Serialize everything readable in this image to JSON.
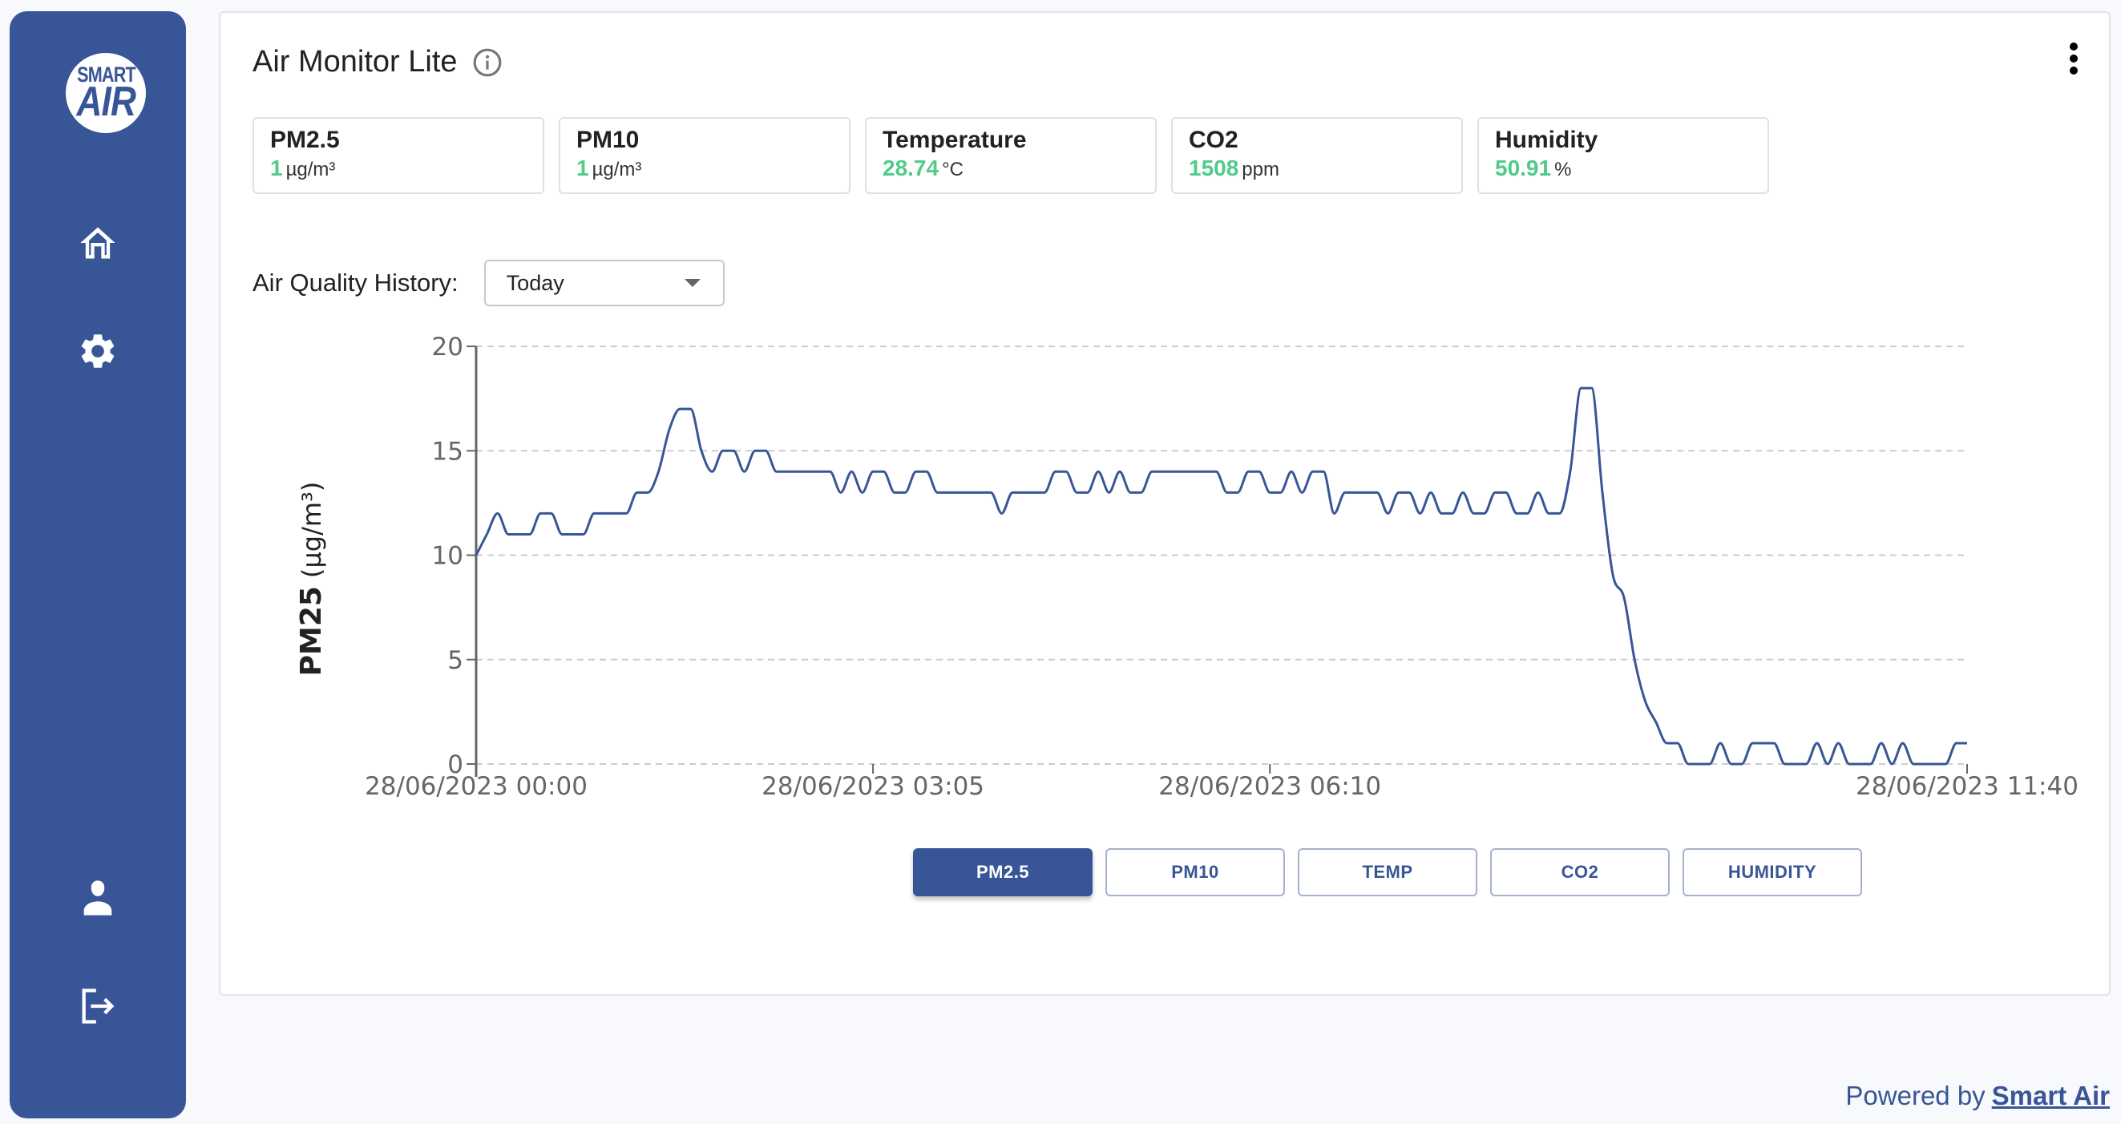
{
  "sidebar": {
    "logo": {
      "line1": "SMART",
      "line2": "AIR"
    },
    "items": [
      {
        "name": "home",
        "icon": "home-icon"
      },
      {
        "name": "settings",
        "icon": "gear-icon"
      },
      {
        "name": "profile",
        "icon": "user-icon"
      },
      {
        "name": "logout",
        "icon": "logout-icon"
      }
    ]
  },
  "header": {
    "title": "Air Monitor Lite",
    "info_icon": "info-icon",
    "menu_icon": "kebab-menu-icon"
  },
  "stats": [
    {
      "label": "PM2.5",
      "value": "1",
      "unit": "µg/m³"
    },
    {
      "label": "PM10",
      "value": "1",
      "unit": "µg/m³"
    },
    {
      "label": "Temperature",
      "value": "28.74",
      "unit": "°C"
    },
    {
      "label": "CO2",
      "value": "1508",
      "unit": "ppm"
    },
    {
      "label": "Humidity",
      "value": "50.91",
      "unit": "%"
    }
  ],
  "history": {
    "label": "Air Quality History:",
    "selected": "Today"
  },
  "metric_buttons": [
    {
      "label": "PM2.5",
      "active": true
    },
    {
      "label": "PM10",
      "active": false
    },
    {
      "label": "TEMP",
      "active": false
    },
    {
      "label": "CO2",
      "active": false
    },
    {
      "label": "HUMIDITY",
      "active": false
    }
  ],
  "footer": {
    "prefix": "Powered by",
    "link": "Smart Air"
  },
  "colors": {
    "brand": "#375597",
    "value_green": "#4fcb8a",
    "line": "#375597"
  },
  "chart_data": {
    "type": "line",
    "title": "",
    "xlabel": "",
    "ylabel": "PM25 (µg/m³)",
    "ylabel_bold": "PM25",
    "ylabel_unit": "(µg/m³)",
    "ylim": [
      0,
      20
    ],
    "yticks": [
      0,
      5,
      10,
      15,
      20
    ],
    "grid": "horizontal-dashed",
    "legend": "none",
    "x_interval_minutes": 5,
    "x_start": "28/06/2023 00:00",
    "xtick_labels": [
      {
        "index": 0,
        "label": "28/06/2023 00:00"
      },
      {
        "index": 37,
        "label": "28/06/2023 03:05"
      },
      {
        "index": 74,
        "label": "28/06/2023 06:10"
      },
      {
        "index": 139,
        "label": "28/06/2023 11:40"
      }
    ],
    "series": [
      {
        "name": "PM2.5",
        "values": [
          10,
          11,
          12,
          11,
          11,
          11,
          12,
          12,
          11,
          11,
          11,
          12,
          12,
          12,
          12,
          13,
          13,
          14,
          16,
          17,
          17,
          15,
          14,
          15,
          15,
          14,
          15,
          15,
          14,
          14,
          14,
          14,
          14,
          14,
          13,
          14,
          13,
          14,
          14,
          13,
          13,
          14,
          14,
          13,
          13,
          13,
          13,
          13,
          13,
          12,
          13,
          13,
          13,
          13,
          14,
          14,
          13,
          13,
          14,
          13,
          14,
          13,
          13,
          14,
          14,
          14,
          14,
          14,
          14,
          14,
          13,
          13,
          14,
          14,
          13,
          13,
          14,
          13,
          14,
          14,
          12,
          13,
          13,
          13,
          13,
          12,
          13,
          13,
          12,
          13,
          12,
          12,
          13,
          12,
          12,
          13,
          13,
          12,
          12,
          13,
          12,
          12,
          14,
          18,
          18,
          13,
          9,
          8,
          5,
          3,
          2,
          1,
          1,
          0,
          0,
          0,
          1,
          0,
          0,
          1,
          1,
          1,
          0,
          0,
          0,
          1,
          0,
          1,
          0,
          0,
          0,
          1,
          0,
          1,
          0,
          0,
          0,
          0,
          1,
          1
        ]
      }
    ]
  }
}
